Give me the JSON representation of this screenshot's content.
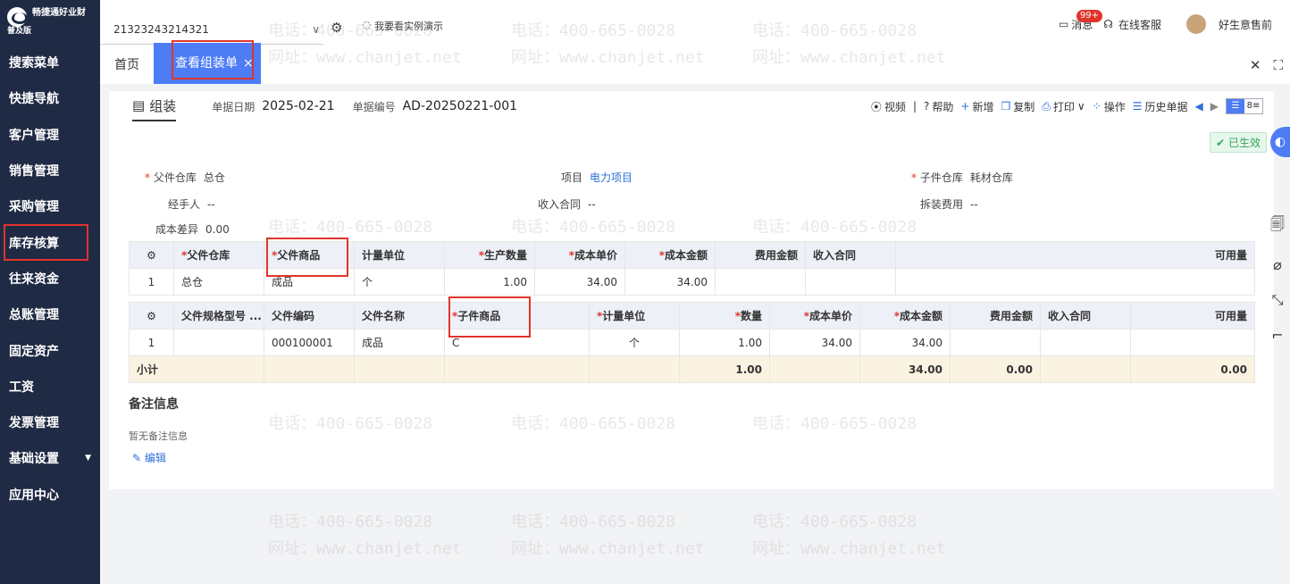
{
  "app": {
    "name": "畅捷通好业财",
    "edition": "普及版"
  },
  "menu": [
    {
      "label": "搜索菜单"
    },
    {
      "label": "快捷导航"
    },
    {
      "label": "客户管理"
    },
    {
      "label": "销售管理"
    },
    {
      "label": "采购管理"
    },
    {
      "label": "库存核算"
    },
    {
      "label": "往来资金"
    },
    {
      "label": "总账管理"
    },
    {
      "label": "固定资产"
    },
    {
      "label": "工资"
    },
    {
      "label": "发票管理"
    },
    {
      "label": "基础设置"
    },
    {
      "label": "应用中心"
    }
  ],
  "topbar": {
    "account": "21323243214321",
    "demo": "我要看实例演示",
    "messages_label": "消息",
    "messages_badge": "99+",
    "service": "在线客服",
    "user": "好生意售前"
  },
  "tabs": {
    "home": "首页",
    "active": "查看组装单",
    "close": "×"
  },
  "document": {
    "type_tab": "组装",
    "date_label": "单据日期",
    "date": "2025-02-21",
    "number_label": "单据编号",
    "number": "AD-20250221-001",
    "status": "已生效"
  },
  "toolbar": {
    "video": "视频",
    "help": "帮助",
    "new": "新增",
    "copy": "复制",
    "print": "打印",
    "operate": "操作",
    "history": "历史单据"
  },
  "fields": {
    "parent_warehouse_label": "父件仓库",
    "parent_warehouse": "总仓",
    "project_label": "项目",
    "project": "电力项目",
    "child_warehouse_label": "子件仓库",
    "child_warehouse": "耗材仓库",
    "handler_label": "经手人",
    "handler": "--",
    "income_contract_label": "收入合同",
    "income_contract": "--",
    "disassembly_cost_label": "拆装费用",
    "disassembly_cost": "--",
    "cost_diff_label": "成本差异",
    "cost_diff": "0.00"
  },
  "parent_table": {
    "headers": [
      "父件仓库",
      "父件商品",
      "计量单位",
      "生产数量",
      "成本单价",
      "成本金额",
      "费用金额",
      "收入合同",
      "可用量"
    ],
    "row": {
      "index": "1",
      "warehouse": "总仓",
      "product": "成品",
      "unit": "个",
      "qty": "1.00",
      "unit_cost": "34.00",
      "amount": "34.00",
      "fee": "",
      "contract": "",
      "available": ""
    }
  },
  "child_table": {
    "headers": [
      "父件规格型号 ...",
      "父件编码",
      "父件名称",
      "子件商品",
      "计量单位",
      "数量",
      "成本单价",
      "成本金额",
      "费用金额",
      "收入合同",
      "可用量"
    ],
    "row": {
      "index": "1",
      "spec": "",
      "code": "000100001",
      "name": "成品",
      "product": "C",
      "unit": "个",
      "qty": "1.00",
      "unit_cost": "34.00",
      "amount": "34.00",
      "fee": "",
      "contract": "",
      "available": ""
    },
    "subtotal": {
      "label": "小计",
      "qty": "1.00",
      "amount": "34.00",
      "fee": "0.00",
      "available": "0.00"
    }
  },
  "remark": {
    "title": "备注信息",
    "empty": "暂无备注信息",
    "edit": "编辑"
  },
  "watermark": {
    "phone": "电话：400-665-0028",
    "site": "网址：www.chanjet.net"
  }
}
